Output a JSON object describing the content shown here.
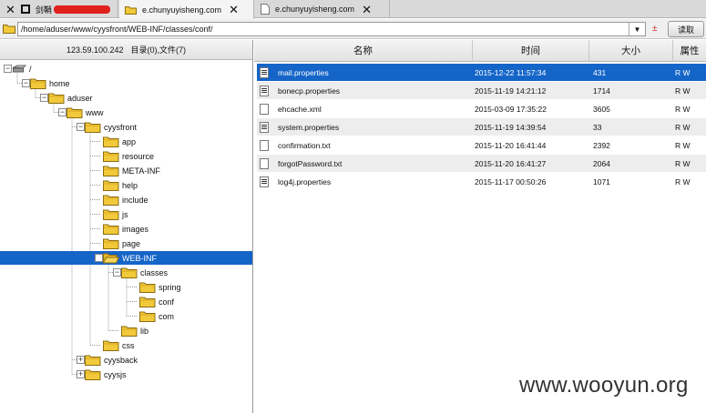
{
  "tabs": [
    {
      "label": "剑鞘",
      "redacted": true
    },
    {
      "label": "e.chunyuyisheng.com"
    },
    {
      "label": "e.chunyuyisheng.com"
    }
  ],
  "address": {
    "value": "/home/aduser/www/cyysfront/WEB-INF/classes/conf/",
    "read_button": "读取",
    "sort_glyph": "±"
  },
  "left_header": {
    "ip": "123.59.100.242",
    "summary": "目录(0),文件(7)"
  },
  "tree": [
    {
      "label": "/",
      "icon": "drive-icon",
      "toggle": "−"
    },
    {
      "label": "home",
      "icon": "folder-icon",
      "toggle": "−"
    },
    {
      "label": "aduser",
      "icon": "folder-icon",
      "toggle": "−"
    },
    {
      "label": "www",
      "icon": "folder-icon",
      "toggle": "−"
    },
    {
      "label": "cyysfront",
      "icon": "folder-icon",
      "toggle": "−"
    },
    {
      "label": "app",
      "icon": "folder-icon"
    },
    {
      "label": "resource",
      "icon": "folder-icon"
    },
    {
      "label": "META-INF",
      "icon": "folder-icon"
    },
    {
      "label": "help",
      "icon": "folder-icon"
    },
    {
      "label": "include",
      "icon": "folder-icon"
    },
    {
      "label": "js",
      "icon": "folder-icon"
    },
    {
      "label": "images",
      "icon": "folder-icon"
    },
    {
      "label": "page",
      "icon": "folder-icon"
    },
    {
      "label": "WEB-INF",
      "icon": "folder-open-icon",
      "selected": true
    },
    {
      "label": "classes",
      "icon": "folder-icon",
      "toggle": "−"
    },
    {
      "label": "spring",
      "icon": "folder-icon"
    },
    {
      "label": "conf",
      "icon": "folder-icon"
    },
    {
      "label": "com",
      "icon": "folder-icon"
    },
    {
      "label": "lib",
      "icon": "folder-icon"
    },
    {
      "label": "css",
      "icon": "folder-icon"
    },
    {
      "label": "cyysback",
      "icon": "folder-icon",
      "toggle": "+"
    },
    {
      "label": "cyysjs",
      "icon": "folder-icon",
      "toggle": "+"
    }
  ],
  "columns": {
    "name": "名称",
    "time": "时间",
    "size": "大小",
    "attr": "属性"
  },
  "files": [
    {
      "name": "mail.properties",
      "time": "2015-12-22 11:57:34",
      "size": "431",
      "attr": "R W",
      "type": "props",
      "selected": true
    },
    {
      "name": "bonecp.properties",
      "time": "2015-11-19 14:21:12",
      "size": "1714",
      "attr": "R W",
      "type": "props"
    },
    {
      "name": "ehcache.xml",
      "time": "2015-03-09 17:35:22",
      "size": "3605",
      "attr": "R W",
      "type": "blank"
    },
    {
      "name": "system.properties",
      "time": "2015-11-19 14:39:54",
      "size": "33",
      "attr": "R W",
      "type": "props"
    },
    {
      "name": "confirmation.txt",
      "time": "2015-11-20 16:41:44",
      "size": "2392",
      "attr": "R W",
      "type": "blank"
    },
    {
      "name": "forgotPassword.txt",
      "time": "2015-11-20 16:41:27",
      "size": "2064",
      "attr": "R W",
      "type": "blank"
    },
    {
      "name": "log4j.properties",
      "time": "2015-11-17 00:50:26",
      "size": "1071",
      "attr": "R W",
      "type": "props"
    }
  ],
  "watermark": "www.wooyun.org",
  "colors": {
    "selection": "#1565c8",
    "folder": "#f2c93a",
    "redaction": "#e0201c"
  }
}
